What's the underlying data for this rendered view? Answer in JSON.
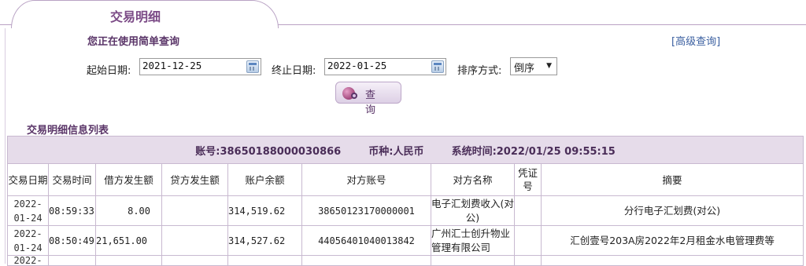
{
  "tab": {
    "title": "交易明细"
  },
  "query": {
    "mode_text": "您正在使用简单查询",
    "advanced_link": "[高级查询]",
    "start_label": "起始日期:",
    "start_value": "2021-12-25",
    "end_label": "终止日期:",
    "end_value": "2022-01-25",
    "sort_label": "排序方式:",
    "sort_value": "倒序",
    "query_button": "查 询"
  },
  "list": {
    "title": "交易明细信息列表",
    "account_label": "账号:",
    "account_value": "38650188000030866",
    "currency_label": "币种:",
    "currency_value": "人民币",
    "systime_label": "系统时间:",
    "systime_value": "2022/01/25 09:55:15"
  },
  "table": {
    "columns": [
      "交易日期",
      "交易时间",
      "借方发生额",
      "贷方发生额",
      "账户余额",
      "对方账号",
      "对方名称",
      "凭证号",
      "摘要"
    ],
    "rows": [
      {
        "date": "2022-01-24",
        "time": "08:59:33",
        "debit": "8.00",
        "credit": "",
        "balance": "314,519.62",
        "counter_account": "38650123170000001",
        "counter_name": "电子汇划费收入(对公)",
        "voucher": "",
        "summary": "分行电子汇划费(对公)"
      },
      {
        "date": "2022-01-24",
        "time": "08:50:49",
        "debit": "21,651.00",
        "credit": "",
        "balance": "314,527.62",
        "counter_account": "44056401040013842",
        "counter_name": "广州汇士创升物业管理有限公司",
        "voucher": "",
        "summary": "汇创壹号203A房2022年2月租金水电管理费等"
      },
      {
        "date": "2022-",
        "time": "",
        "debit": "",
        "credit": "",
        "balance": "",
        "counter_account": "",
        "counter_name": "",
        "voucher": "",
        "summary": ""
      }
    ]
  },
  "colors": {
    "accent": "#7b4a86",
    "header_band": "#e6dcea",
    "border": "#c8b9d0",
    "link": "#3a5fa0"
  },
  "icons": [
    "calendar-icon",
    "globe-search-icon",
    "dropdown-arrow-icon"
  ]
}
